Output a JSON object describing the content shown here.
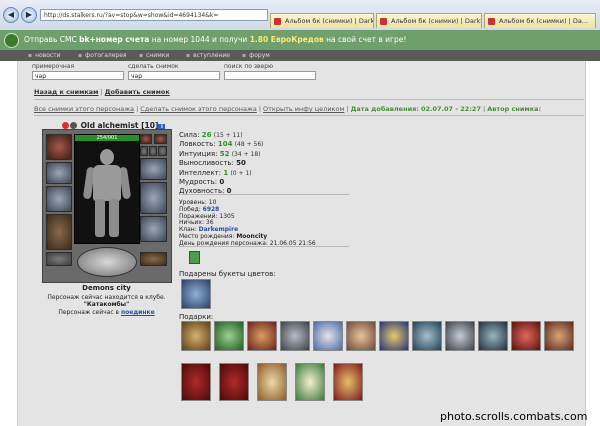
{
  "browser": {
    "url": "http://ds.stalkers.ru/?av=stop&w=show&id=4694134&k=",
    "tabs": [
      {
        "label": "Альбом бк (снимки) | DarkS..."
      },
      {
        "label": "Альбом бк (снимки) | DarkS..."
      },
      {
        "label": "Альбом бк (снимки) | Da..."
      }
    ]
  },
  "promo": {
    "t1": "Отправь СМС ",
    "t2": "bk+номер счета",
    "t3": " на номер 1044 и получи ",
    "t4": "1.80 ЕвроКредов",
    "t5": " на свой счет в игре!"
  },
  "menu": {
    "items": [
      {
        "label": "новости"
      },
      {
        "label": "фотогалерея"
      },
      {
        "label": "снимки"
      },
      {
        "label": "вступление"
      },
      {
        "label": "форум"
      }
    ]
  },
  "filters": {
    "f1_label": "примерочная",
    "f1_value": "чар",
    "f2_label": "сделать снимок",
    "f2_value": "чар",
    "f3_label": "поиск по зверю",
    "f3_value": ""
  },
  "nav": {
    "back": "Назад к снимкам",
    "add": "Добавить снимок"
  },
  "actions": {
    "all": "Все снимки этого персонажа",
    "make": "Сделать снимок этого персонажа",
    "open": "Открыть инфу целиком",
    "date_label": "Дата добавления:",
    "date_value": "02.07.07 - 22:27",
    "author_label": "Автор снимка:"
  },
  "character": {
    "name": "Old alchemist",
    "level_tag": "[10]",
    "info_badge": "i",
    "hp": "254/001",
    "location": "Demons city",
    "status1": "Персонаж сейчас находится в клубе.",
    "club": "\"Катакомбы\"",
    "status2": "Персонаж сейчас в ",
    "status2_place": "поединке"
  },
  "stats": [
    {
      "label": "Сила:",
      "value": "26",
      "mod": "(15 + 11)"
    },
    {
      "label": "Ловкость:",
      "value": "104",
      "mod": "(48 + 56)"
    },
    {
      "label": "Интуиция:",
      "value": "52",
      "mod": "(34 + 18)"
    },
    {
      "label": "Выносливость:",
      "value": "50",
      "mod": ""
    },
    {
      "label": "Интеллект:",
      "value": "1",
      "mod": "(0 + 1)"
    },
    {
      "label": "Мудрость:",
      "value": "0",
      "mod": ""
    },
    {
      "label": "Духовность:",
      "value": "0",
      "mod": ""
    }
  ],
  "info": {
    "level": "Уровень: 10",
    "wins_label": "Побед: ",
    "wins": "6928",
    "losses": "Поражений: 1305",
    "draws": "Ничьих: 36",
    "clan_label": "Клан: ",
    "clan": "Darkempire",
    "birthplace_label": "Место рождения: ",
    "birthplace": "Mooncity",
    "birthday": "День рождения персонажа: 21.06.05 21:56"
  },
  "gifts": {
    "flowers_label": "Подарены букеты цветов:",
    "gifts_label": "Подарки:"
  },
  "watermark": "photo.scrolls.combats.com"
}
